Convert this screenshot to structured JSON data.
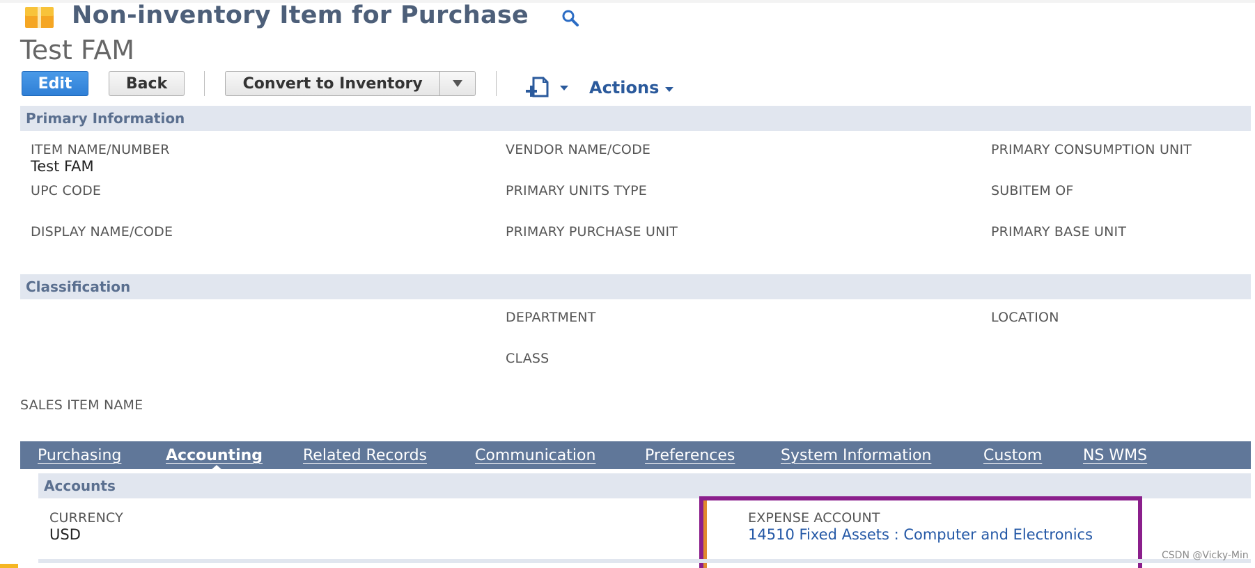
{
  "header": {
    "record_type": "Non-inventory Item for Purchase",
    "record_name": "Test FAM"
  },
  "toolbar": {
    "edit_label": "Edit",
    "back_label": "Back",
    "convert_label": "Convert to Inventory",
    "actions_label": "Actions"
  },
  "primary_info": {
    "title": "Primary Information",
    "item_name_label": "ITEM NAME/NUMBER",
    "item_name_value": "Test FAM",
    "vendor_name_label": "VENDOR NAME/CODE",
    "primary_consumption_unit_label": "PRIMARY CONSUMPTION UNIT",
    "upc_code_label": "UPC CODE",
    "primary_units_type_label": "PRIMARY UNITS TYPE",
    "subitem_of_label": "SUBITEM OF",
    "display_name_label": "DISPLAY NAME/CODE",
    "primary_purchase_unit_label": "PRIMARY PURCHASE UNIT",
    "primary_base_unit_label": "PRIMARY BASE UNIT"
  },
  "classification": {
    "title": "Classification",
    "department_label": "DEPARTMENT",
    "location_label": "LOCATION",
    "class_label": "CLASS"
  },
  "sales_item_name_label": "SALES ITEM NAME",
  "tabs": [
    {
      "label": "Purchasing"
    },
    {
      "label": "Accounting"
    },
    {
      "label": "Related Records"
    },
    {
      "label": "Communication"
    },
    {
      "label": "Preferences"
    },
    {
      "label": "System Information"
    },
    {
      "label": "Custom"
    },
    {
      "label": "NS WMS"
    }
  ],
  "active_tab": "Accounting",
  "accounts": {
    "title": "Accounts",
    "currency_label": "CURRENCY",
    "currency_value": "USD",
    "expense_account_label": "EXPENSE ACCOUNT",
    "expense_account_value": "14510 Fixed Assets : Computer and Electronics"
  },
  "watermark": "CSDN @Vicky-Min",
  "colors": {
    "header_text": "#4d5f79",
    "edit_button": "#2f7fd6",
    "link": "#2458a6",
    "section_bar": "#e1e6ef",
    "tab_bar": "#607799",
    "highlight_box": "#8b1f8c"
  },
  "icons": {
    "record_icon": "package-icon",
    "search": "search-icon",
    "new": "new-record-icon"
  }
}
